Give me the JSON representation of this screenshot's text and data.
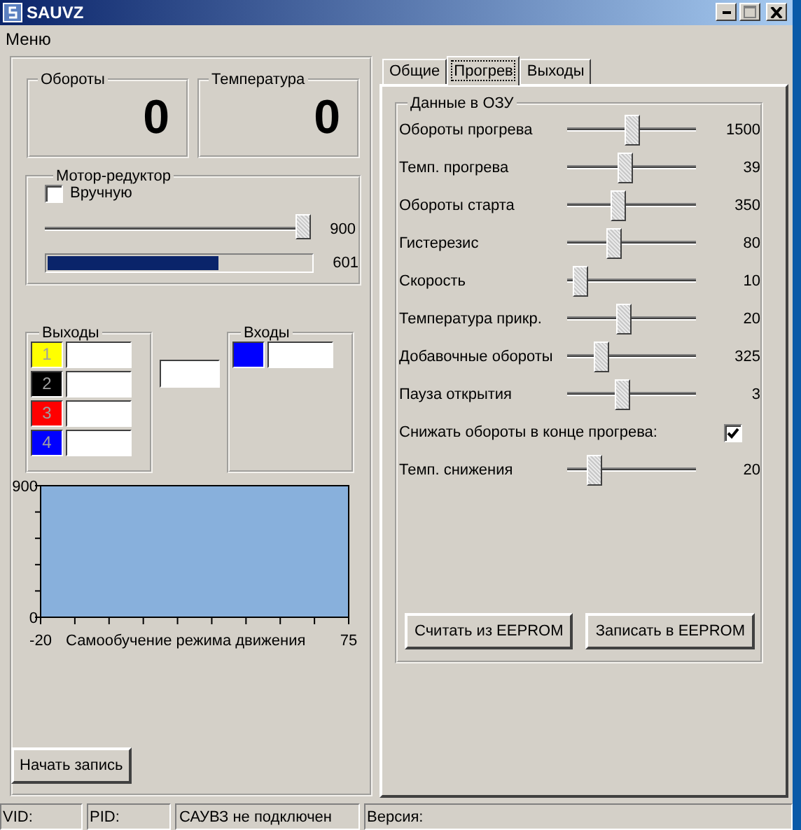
{
  "window": {
    "title": "SAUVZ"
  },
  "menu": [
    "Меню"
  ],
  "readouts": [
    {
      "label": "Обороты",
      "value": "0"
    },
    {
      "label": "Температура",
      "value": "0"
    }
  ],
  "motor": {
    "title": "Мотор-редуктор",
    "manual": {
      "label": "Вручную",
      "checked": false
    },
    "slider": {
      "level": 1,
      "reading": "900"
    },
    "progress": {
      "level": 0.65,
      "reading": "601"
    }
  },
  "outputs": {
    "title": "Выходы",
    "items": [
      {
        "label": "1",
        "color": "#ffff00"
      },
      {
        "label": "2",
        "color": "#000000"
      },
      {
        "label": "3",
        "color": "#ff0000"
      },
      {
        "label": "4",
        "color": "#0000ff"
      }
    ]
  },
  "inputs": {
    "title": "Входы",
    "items": [
      {
        "color": "#0000ff"
      }
    ]
  },
  "chart": {
    "chart_data": {
      "type": "line",
      "xlabel": "Самообучение режима движения",
      "xlim": [
        -20,
        75
      ],
      "ylim": [
        0,
        900
      ],
      "xticks": [
        -20,
        75
      ],
      "yticks": [
        0,
        900
      ]
    }
  },
  "record_button": "Начать запись",
  "tabs": [
    {
      "label": "Общие",
      "selected": false
    },
    {
      "label": "Прогрев",
      "selected": true
    },
    {
      "label": "Выходы",
      "selected": false
    }
  ],
  "ram_data": {
    "title": "Данные в ОЗУ",
    "rows": [
      {
        "kind": "slider",
        "label": "Обороты прогрева",
        "level": 0.51,
        "reading": "1500"
      },
      {
        "kind": "slider",
        "label": "Темп. прогрева",
        "level": 0.45,
        "reading": "39"
      },
      {
        "kind": "slider",
        "label": "Обороты старта",
        "level": 0.38,
        "reading": "350"
      },
      {
        "kind": "slider",
        "label": "Гистерезис",
        "level": 0.35,
        "reading": "80"
      },
      {
        "kind": "slider",
        "label": "Скорость",
        "level": 0.05,
        "reading": "10"
      },
      {
        "kind": "slider",
        "label": "Температура прикр.",
        "level": 0.43,
        "reading": "20"
      },
      {
        "kind": "slider",
        "label": "Добавочные обороты",
        "level": 0.24,
        "reading": "325"
      },
      {
        "kind": "slider",
        "label": "Пауза открытия",
        "level": 0.42,
        "reading": "3"
      },
      {
        "kind": "checkbox",
        "label": "Снижать обороты в конце прогрева:",
        "checked": true
      },
      {
        "kind": "slider",
        "label": "Темп. снижения",
        "level": 0.17,
        "reading": "20"
      }
    ]
  },
  "buttons": [
    "Считать из EEPROM",
    "Записать в EEPROM"
  ],
  "status_bar": [
    "VID:",
    "PID:",
    "САУВЗ не подключен",
    "Версия:"
  ]
}
